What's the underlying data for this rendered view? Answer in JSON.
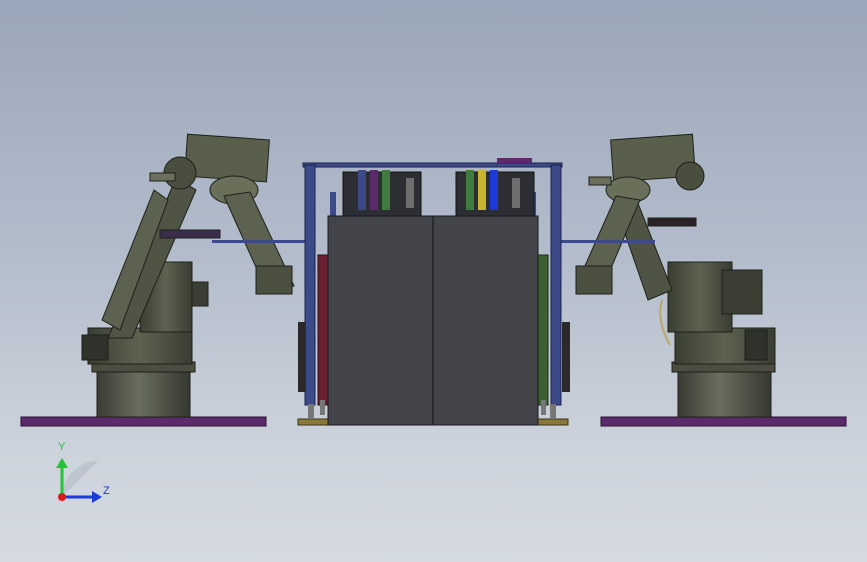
{
  "triad": {
    "y_label": "Y",
    "z_label": "Z",
    "y_color": "#25c23a",
    "z_color": "#1c3ad8",
    "x_color": "#d81c1c"
  },
  "colors": {
    "background_top": "#9aa6b9",
    "background_bottom": "#d5dae1",
    "floor_plate": "#5a2a6b",
    "robot_body": "#4b5040",
    "robot_highlight": "#6b7058",
    "cabinet": "#434449",
    "frame": "#3d4a8a"
  }
}
